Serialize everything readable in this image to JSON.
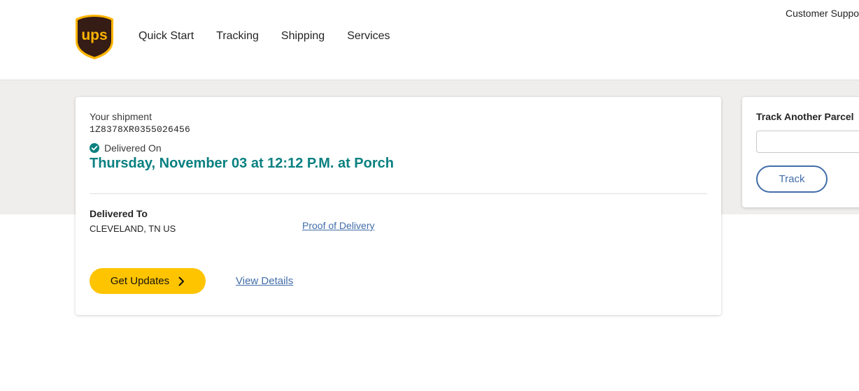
{
  "header": {
    "logo_text": "ups",
    "nav": [
      "Quick Start",
      "Tracking",
      "Shipping",
      "Services"
    ],
    "top_link": "Customer Suppo"
  },
  "shipment": {
    "label": "Your shipment",
    "tracking_number": "1Z8378XR0355026456",
    "status_icon": "check-circle-icon",
    "status_label": "Delivered On",
    "delivered_datetime": "Thursday, November 03 at 12:12 P.M. at Porch",
    "delivered_to_label": "Delivered To",
    "delivered_to_value": "CLEVELAND, TN US",
    "proof_link": "Proof of Delivery",
    "updates_button": "Get Updates",
    "view_details_link": "View Details"
  },
  "track_another": {
    "title": "Track Another Parcel",
    "input_value": "",
    "button": "Track"
  },
  "colors": {
    "ups_brown": "#351c15",
    "ups_gold": "#ffb500",
    "status_teal": "#0a8080",
    "link_blue": "#426da9",
    "button_yellow": "#ffc400"
  }
}
